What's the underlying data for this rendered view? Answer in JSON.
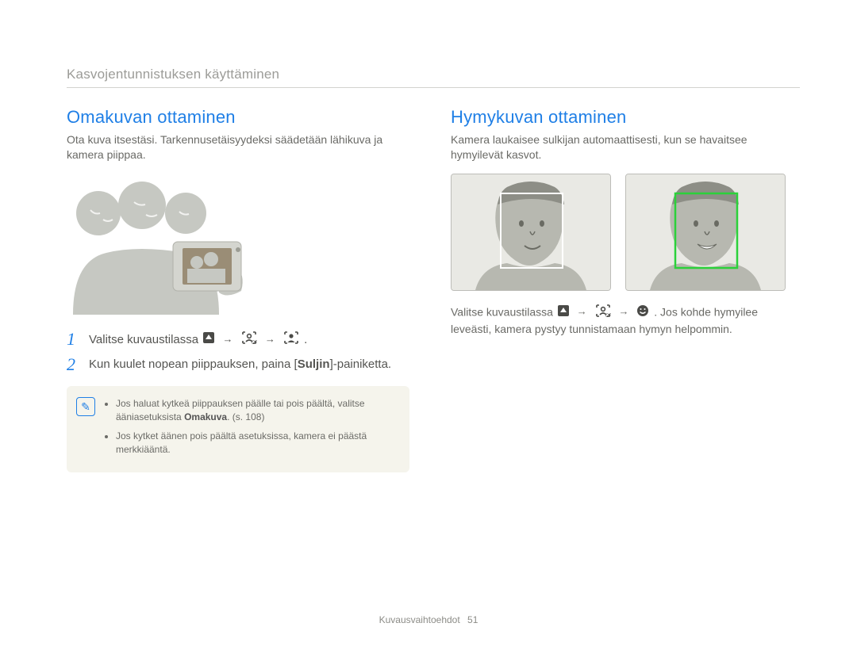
{
  "header": "Kasvojentunnistuksen käyttäminen",
  "left": {
    "title": "Omakuvan ottaminen",
    "lead": "Ota kuva itsestäsi. Tarkennusetäisyydeksi säädetään lähikuva ja kamera piippaa.",
    "step1_prefix": "Valitse kuvaustilassa ",
    "step2_before": "Kun kuulet nopean piippauksen, paina [",
    "step2_button": "Suljin",
    "step2_after": "]-painiketta.",
    "note_li1_before": "Jos haluat kytkeä piippauksen päälle tai pois päältä, valitse ääniasetuksista ",
    "note_li1_bold": "Omakuva",
    "note_li1_after": ". (s. 108)",
    "note_li2": "Jos kytket äänen pois päältä asetuksissa, kamera ei päästä merkkiääntä."
  },
  "right": {
    "title": "Hymykuvan ottaminen",
    "lead": "Kamera laukaisee sulkijan automaattisesti, kun se havaitsee hymyilevät kasvot.",
    "para_prefix": "Valitse kuvaustilassa ",
    "para_suffix": ". Jos kohde hymyilee leveästi, kamera pystyy tunnistamaan hymyn helpommin."
  },
  "icons": {
    "menu": "menu-up-triangle",
    "face_off": "face-off-icon",
    "self_portrait": "self-portrait-icon",
    "smile": "smile-icon"
  },
  "footer": {
    "section": "Kuvausvaihtoehdot",
    "page": "51"
  }
}
